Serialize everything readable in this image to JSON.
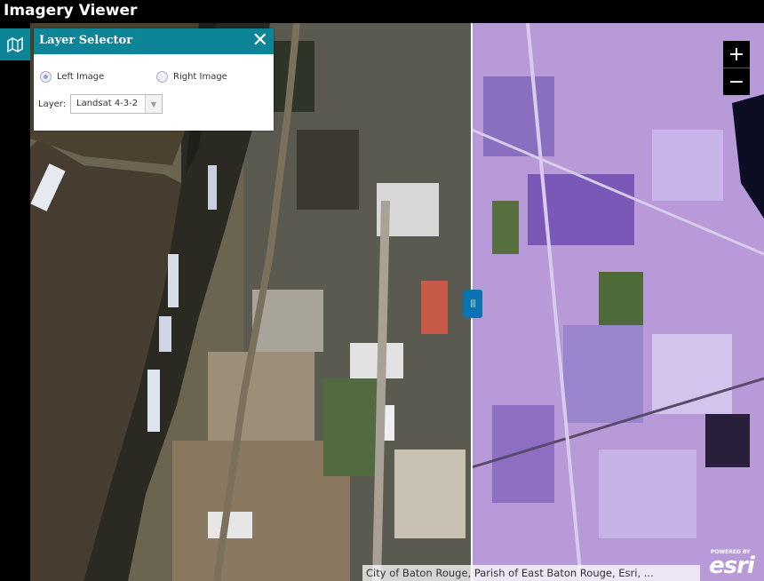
{
  "app": {
    "title": "Imagery Viewer"
  },
  "panel": {
    "title": "Layer Selector",
    "close_glyph": "✕",
    "options": [
      {
        "label": "Left Image",
        "selected": true
      },
      {
        "label": "Right Image",
        "selected": false
      }
    ],
    "layer_label": "Layer:",
    "layer_value": "Landsat 4-3-2"
  },
  "map": {
    "zoom_in": "+",
    "zoom_out": "−",
    "swipe_handle_glyph": "|||",
    "attribution": "City of Baton Rouge, Parish of East Baton Rouge, Esri, ...",
    "logo_small": "POWERED BY",
    "logo_text": "esri"
  },
  "colors": {
    "accent": "#0e8596",
    "swipe_handle": "#0b74b0",
    "river": "#463d30"
  },
  "icons": {
    "layers_button": "map-layers-icon"
  }
}
